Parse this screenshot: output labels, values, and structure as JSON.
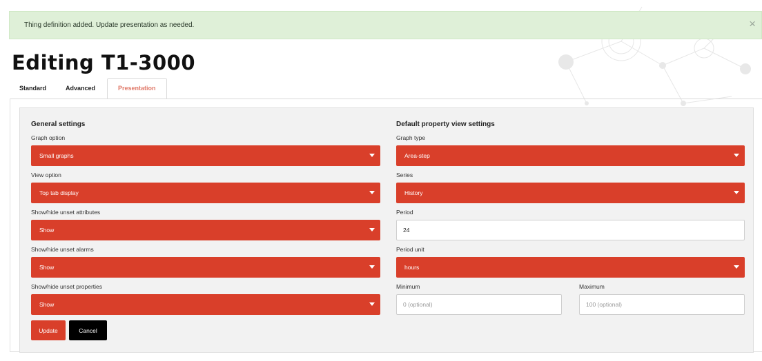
{
  "alert": {
    "message": "Thing definition added. Update presentation as needed.",
    "close_glyph": "×"
  },
  "page": {
    "title": "Editing T1-3000"
  },
  "tabs": [
    {
      "label": "Standard",
      "active": false
    },
    {
      "label": "Advanced",
      "active": false
    },
    {
      "label": "Presentation",
      "active": true
    }
  ],
  "general": {
    "title": "General settings",
    "graph_option": {
      "label": "Graph option",
      "value": "Small graphs"
    },
    "view_option": {
      "label": "View option",
      "value": "Top tab display"
    },
    "unset_attributes": {
      "label": "Show/hide unset attributes",
      "value": "Show"
    },
    "unset_alarms": {
      "label": "Show/hide unset alarms",
      "value": "Show"
    },
    "unset_properties": {
      "label": "Show/hide unset properties",
      "value": "Show"
    }
  },
  "defaults": {
    "title": "Default property view settings",
    "graph_type": {
      "label": "Graph type",
      "value": "Area-step"
    },
    "series": {
      "label": "Series",
      "value": "History"
    },
    "period": {
      "label": "Period",
      "value": "24"
    },
    "period_unit": {
      "label": "Period unit",
      "value": "hours"
    },
    "minimum": {
      "label": "Minimum",
      "placeholder": "0 (optional)"
    },
    "maximum": {
      "label": "Maximum",
      "placeholder": "100 (optional)"
    }
  },
  "buttons": {
    "update": "Update",
    "cancel": "Cancel"
  },
  "colors": {
    "accent": "#d93f2a",
    "success_bg": "#dff0d8",
    "tab_active": "#e07a6a"
  }
}
